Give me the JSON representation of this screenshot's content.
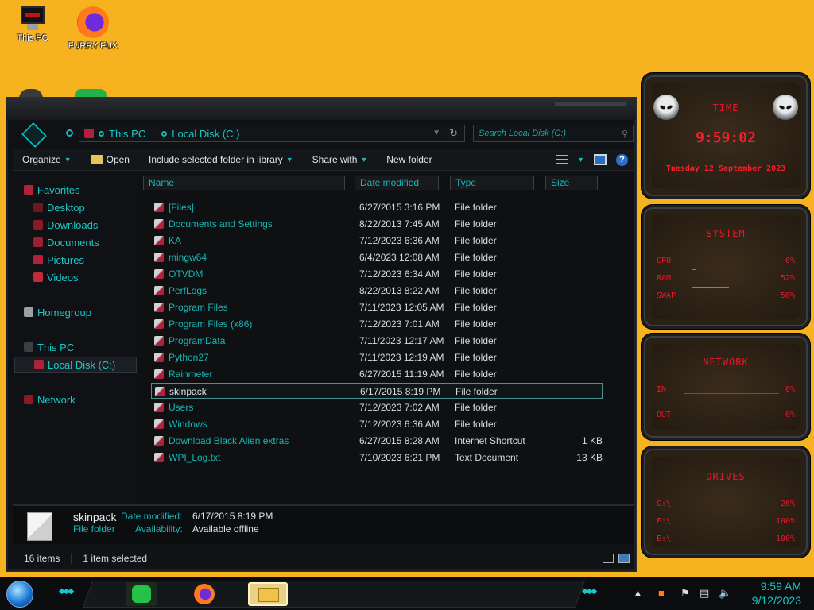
{
  "desktop": {
    "icons": [
      {
        "label": "This PC",
        "icon": "this-pc-icon"
      },
      {
        "label": "FURRY FUX",
        "icon": "firefox-icon"
      }
    ]
  },
  "window": {
    "breadcrumb": [
      "This PC",
      "Local Disk (C:)"
    ],
    "search_placeholder": "Search Local Disk (C:)",
    "toolbar": {
      "organize": "Organize",
      "open": "Open",
      "include": "Include selected folder in library",
      "share": "Share with",
      "new_folder": "New folder"
    },
    "nav": {
      "favorites": "Favorites",
      "desktop": "Desktop",
      "downloads": "Downloads",
      "documents": "Documents",
      "pictures": "Pictures",
      "videos": "Videos",
      "homegroup": "Homegroup",
      "this_pc": "This PC",
      "local_disk": "Local Disk (C:)",
      "network": "Network"
    },
    "columns": {
      "name": "Name",
      "date": "Date modified",
      "type": "Type",
      "size": "Size"
    },
    "files": [
      {
        "name": "[Files]",
        "date": "6/27/2015 3:16 PM",
        "type": "File folder",
        "size": ""
      },
      {
        "name": "Documents and Settings",
        "date": "8/22/2013 7:45 AM",
        "type": "File folder",
        "size": ""
      },
      {
        "name": "KA",
        "date": "7/12/2023 6:36 AM",
        "type": "File folder",
        "size": ""
      },
      {
        "name": "mingw64",
        "date": "6/4/2023 12:08 AM",
        "type": "File folder",
        "size": ""
      },
      {
        "name": "OTVDM",
        "date": "7/12/2023 6:34 AM",
        "type": "File folder",
        "size": ""
      },
      {
        "name": "PerfLogs",
        "date": "8/22/2013 8:22 AM",
        "type": "File folder",
        "size": ""
      },
      {
        "name": "Program Files",
        "date": "7/11/2023 12:05 AM",
        "type": "File folder",
        "size": ""
      },
      {
        "name": "Program Files (x86)",
        "date": "7/12/2023 7:01 AM",
        "type": "File folder",
        "size": ""
      },
      {
        "name": "ProgramData",
        "date": "7/11/2023 12:17 AM",
        "type": "File folder",
        "size": ""
      },
      {
        "name": "Python27",
        "date": "7/11/2023 12:19 AM",
        "type": "File folder",
        "size": ""
      },
      {
        "name": "Rainmeter",
        "date": "6/27/2015 11:19 AM",
        "type": "File folder",
        "size": ""
      },
      {
        "name": "skinpack",
        "date": "6/17/2015 8:19 PM",
        "type": "File folder",
        "size": ""
      },
      {
        "name": "Users",
        "date": "7/12/2023 7:02 AM",
        "type": "File folder",
        "size": ""
      },
      {
        "name": "Windows",
        "date": "7/12/2023 6:36 AM",
        "type": "File folder",
        "size": ""
      },
      {
        "name": "Download Black Alien extras",
        "date": "6/27/2015 8:28 AM",
        "type": "Internet Shortcut",
        "size": "1 KB"
      },
      {
        "name": "WPI_Log.txt",
        "date": "7/10/2023 6:21 PM",
        "type": "Text Document",
        "size": "13 KB"
      }
    ],
    "selected_index": 11,
    "details": {
      "name": "skinpack",
      "date_label": "Date modified:",
      "date_value": "6/17/2015 8:19 PM",
      "type_value": "File folder",
      "avail_label": "Availability:",
      "avail_value": "Available offline"
    },
    "status": {
      "items": "16 items",
      "selected": "1 item selected"
    }
  },
  "widgets": {
    "time": {
      "title": "TIME",
      "clock": "9:59:02",
      "date": "Tuesday 12 September 2023"
    },
    "system": {
      "title": "SYSTEM",
      "rows": [
        {
          "label": "CPU",
          "value": "6%"
        },
        {
          "label": "RAM",
          "value": "52%"
        },
        {
          "label": "SWAP",
          "value": "56%"
        }
      ],
      "levels": [
        0.06,
        0.52,
        0.56
      ]
    },
    "network": {
      "title": "NETWORK",
      "rows": [
        {
          "label": "IN",
          "value": "0%"
        },
        {
          "label": "OUT",
          "value": "0%"
        }
      ]
    },
    "drives": {
      "title": "DRIVES",
      "rows": [
        {
          "label": "C:\\",
          "value": "26%"
        },
        {
          "label": "F:\\",
          "value": "100%"
        },
        {
          "label": "E:\\",
          "value": "100%"
        }
      ]
    }
  },
  "taskbar": {
    "time": "9:59 AM",
    "date": "9/12/2023"
  }
}
